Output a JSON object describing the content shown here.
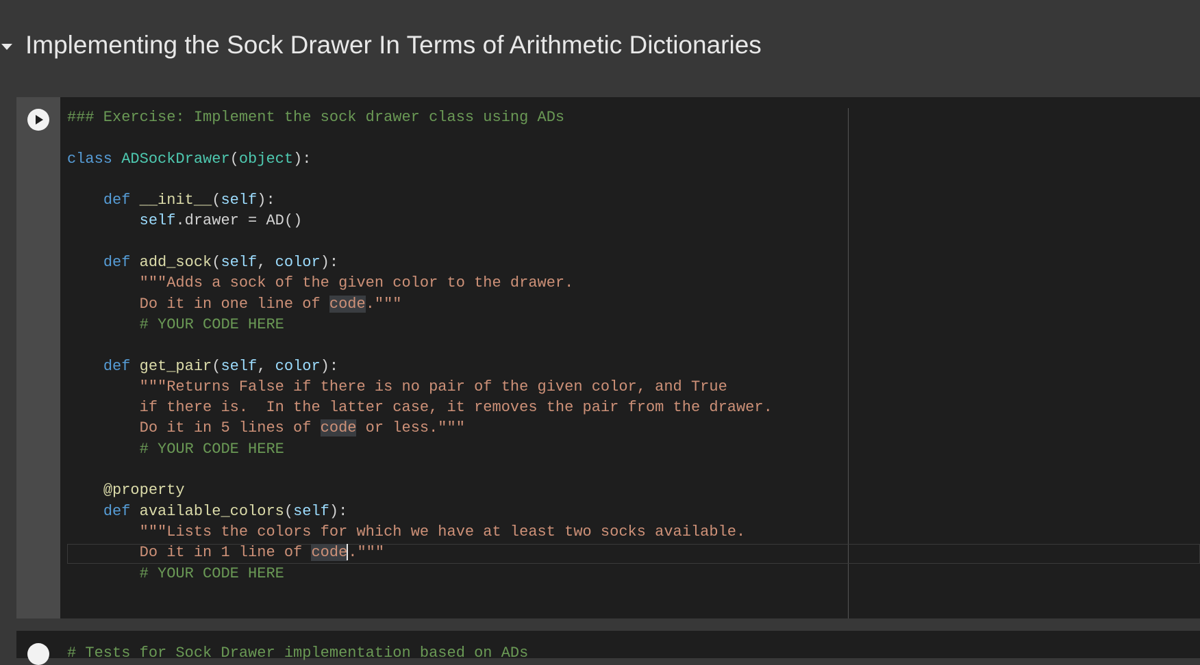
{
  "section": {
    "title": "Implementing the Sock Drawer In Terms of Arithmetic Dictionaries"
  },
  "cell": {
    "lines": [
      "### Exercise: Implement the sock drawer class using ADs",
      "",
      "class ADSockDrawer(object):",
      "",
      "    def __init__(self):",
      "        self.drawer = AD()",
      "",
      "    def add_sock(self, color):",
      "        \"\"\"Adds a sock of the given color to the drawer.",
      "        Do it in one line of code.\"\"\"",
      "        # YOUR CODE HERE",
      "",
      "    def get_pair(self, color):",
      "        \"\"\"Returns False if there is no pair of the given color, and True",
      "        if there is.  In the latter case, it removes the pair from the drawer.",
      "        Do it in 5 lines of code or less.\"\"\"",
      "        # YOUR CODE HERE",
      "",
      "    @property",
      "    def available_colors(self):",
      "        \"\"\"Lists the colors for which we have at least two socks available.",
      "        Do it in 1 line of code.\"\"\"",
      "        # YOUR CODE HERE"
    ]
  },
  "next_cell": {
    "first_line": "# Tests for Sock Drawer implementation based on ADs"
  },
  "icons": {
    "collapse": "caret-down-icon",
    "run": "play-icon"
  },
  "colors": {
    "background": "#383838",
    "cell_bg": "#1e1e1e",
    "gutter": "#4a4a4a",
    "comment": "#6a9955",
    "keyword": "#569cd6",
    "class_name": "#4ec9b0",
    "function_name": "#dcdcaa",
    "self": "#9cdcfe",
    "string": "#ce9178"
  }
}
